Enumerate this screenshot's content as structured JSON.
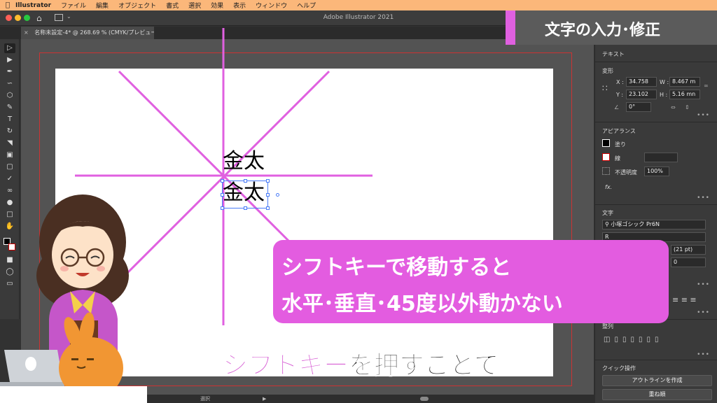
{
  "menubar": {
    "app_name": "Illustrator",
    "items": [
      "ファイル",
      "編集",
      "オブジェクト",
      "書式",
      "選択",
      "効果",
      "表示",
      "ウィンドウ",
      "ヘルプ"
    ]
  },
  "window": {
    "title": "Adobe Illustrator 2021",
    "doc_tab": "名称未設定-4* @ 268.69 % (CMYK/プレビュー)",
    "close_glyph": "×"
  },
  "canvas": {
    "text_line1": "金太",
    "text_line2": "金太",
    "guide_color": "#e060e0",
    "selection_color": "#4a7cf7"
  },
  "panels": {
    "text_section": "テキスト",
    "transform": {
      "title": "変形",
      "x_label": "X :",
      "x_value": "34.758",
      "y_label": "Y :",
      "y_value": "23.102",
      "w_label": "W :",
      "w_value": "8.467 m",
      "h_label": "H :",
      "h_value": "5.16 mn",
      "angle_value": "0°"
    },
    "appearance": {
      "title": "アピアランス",
      "fill_label": "塗り",
      "stroke_label": "線",
      "opacity_label": "不透明度",
      "opacity_value": "100%",
      "fx_label": "fx."
    },
    "character": {
      "title": "文字",
      "font_family": "小塚ゴシック Pr6N",
      "font_style": "R",
      "leading": "(21 pt)",
      "tracking": "0"
    },
    "align": {
      "title": "整列"
    },
    "quick_actions": {
      "title": "クイック操作",
      "outline_button": "アウトラインを作成",
      "arrange_button": "重ね順"
    }
  },
  "statusbar": {
    "tool_label": "選択"
  },
  "overlay": {
    "section_title": "文字の入力･修正",
    "callout_line1": "シフトキーで移動すると",
    "callout_line2": "水平･垂直･45度以外動かない",
    "subtitle_highlight": "シフトキー",
    "subtitle_rest": "を押すことで",
    "accent_color": "#e35ce0"
  }
}
